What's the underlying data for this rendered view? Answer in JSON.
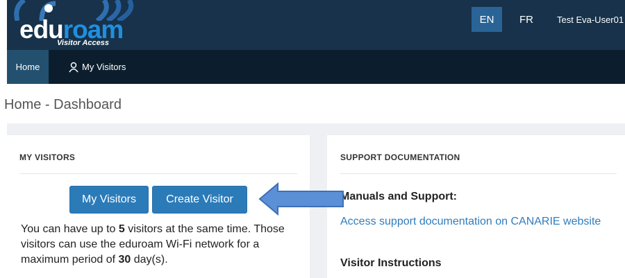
{
  "header": {
    "logo_text": "eduroam",
    "logo_subtitle": "Visitor Access",
    "languages": [
      {
        "label": "EN",
        "active": true
      },
      {
        "label": "FR",
        "active": false
      }
    ],
    "user_menu_label": "Test Eva-User01",
    "colors": {
      "header_bg": "#17324a",
      "nav_bg": "#0c1e2d",
      "active_lang_bg": "#2a6496"
    }
  },
  "nav": {
    "home_label": "Home",
    "my_visitors_label": "My Visitors",
    "my_visitors_icon": "user-icon"
  },
  "page": {
    "title": "Home - Dashboard"
  },
  "my_visitors_panel": {
    "heading": "MY VISITORS",
    "buttons": {
      "my_visitors": "My Visitors",
      "create_visitor": "Create Visitor"
    },
    "description": {
      "part1": "You can have up to ",
      "max_visitors": "5",
      "part2": " visitors at the same time. Those visitors can use the eduroam Wi-Fi network for a maximum period of ",
      "max_days": "30",
      "part3": " day(s)."
    },
    "button_color": "#2b7bb9"
  },
  "support_panel": {
    "heading": "SUPPORT DOCUMENTATION",
    "manuals_heading": "Manuals and Support:",
    "support_link": "Access support documentation on CANARIE website",
    "visitor_instructions_heading": "Visitor Instructions",
    "link_color": "#2f7dbd"
  },
  "annotation": {
    "arrow_icon": "left-arrow-callout",
    "arrow_color": "#5b8fd6"
  }
}
